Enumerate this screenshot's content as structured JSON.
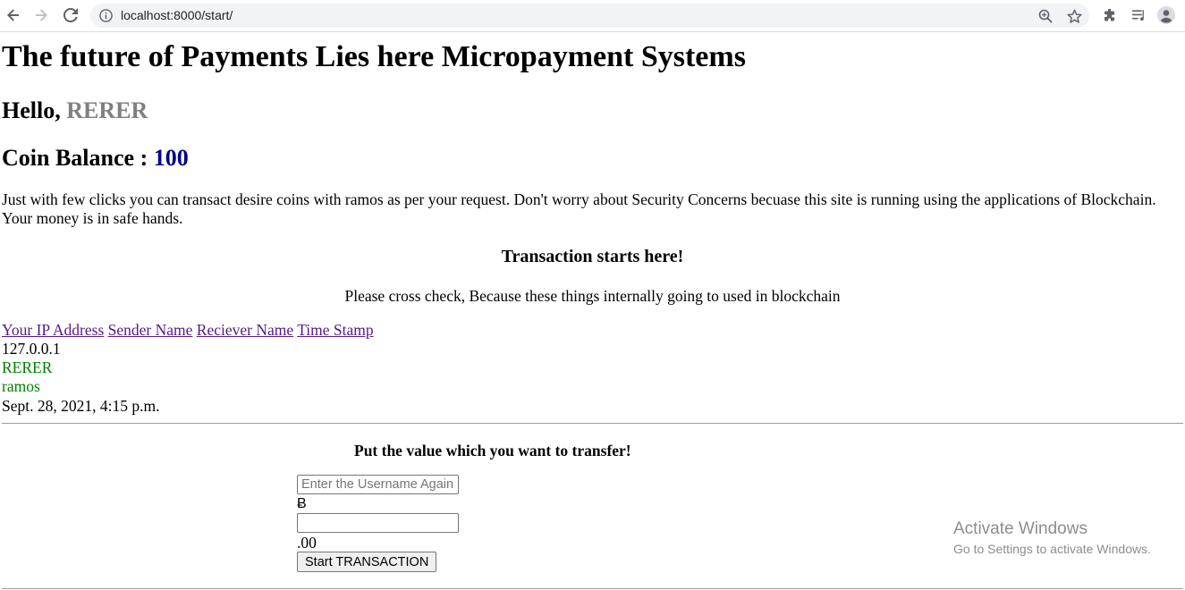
{
  "browser": {
    "url": "localhost:8000/start/"
  },
  "page": {
    "title": "The future of Payments Lies here Micropayment Systems",
    "hello_prefix": "Hello, ",
    "user_name": "RERER",
    "balance_label": "Coin Balance : ",
    "balance_value": "100",
    "intro": "Just with few clicks you can transact desire coins with ramos as per your request. Don't worry about Security Concerns becuase this site is running using the applications of Blockchain. Your money is in safe hands.",
    "tx_heading": "Transaction starts here!",
    "tx_sub": "Please cross check, Because these things internally going to used in blockchain",
    "links": [
      "Your IP Address",
      "Sender Name",
      "Reciever Name",
      "Time Stamp"
    ],
    "ip_address": "127.0.0.1",
    "sender_name": "RERER",
    "receiver_name": "ramos",
    "timestamp": "Sept. 28, 2021, 4:15 p.m."
  },
  "form": {
    "heading": "Put the value which you want to transfer!",
    "username_placeholder": "Enter the Username Again",
    "currency_symbol": "Ƀ",
    "amount_value": "",
    "cents": ".00",
    "submit_label": "Start TRANSACTION"
  },
  "watermark": {
    "line1": "Activate Windows",
    "line2": "Go to Settings to activate Windows."
  }
}
